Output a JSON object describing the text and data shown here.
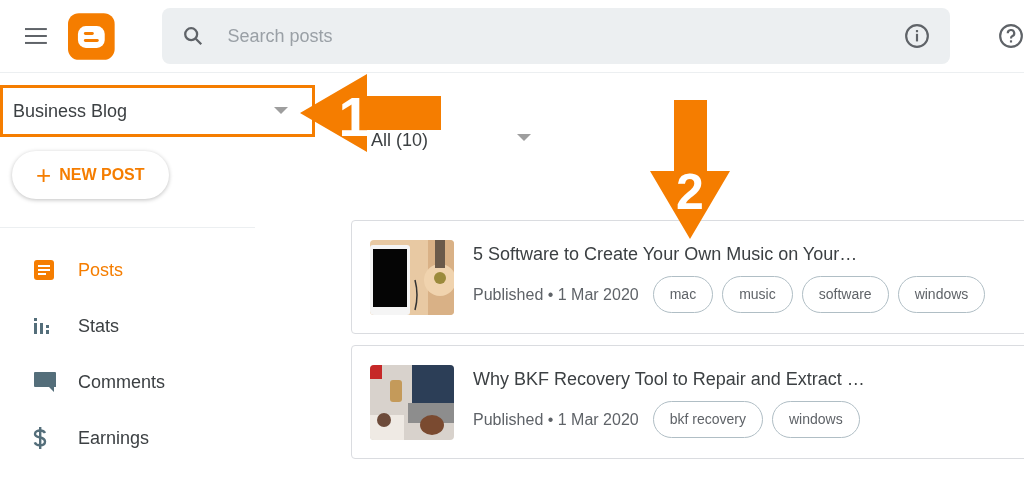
{
  "header": {
    "search": {
      "placeholder": "Search posts"
    }
  },
  "sidebar": {
    "blog_selector": {
      "value": "Business Blog"
    },
    "new_post_button": {
      "icon": "+",
      "label": "NEW POST"
    },
    "items": [
      {
        "kind": "posts",
        "label": "Posts",
        "selected": true
      },
      {
        "kind": "stats",
        "label": "Stats",
        "selected": false
      },
      {
        "kind": "comments",
        "label": "Comments",
        "selected": false
      },
      {
        "kind": "earnings",
        "label": "Earnings",
        "selected": false
      }
    ]
  },
  "filter": {
    "value": "All (10)"
  },
  "posts": [
    {
      "title": "5 Software to Create Your Own Music on Your…",
      "status": "Published • 1 Mar 2020",
      "labels": [
        "mac",
        "music",
        "software",
        "windows"
      ]
    },
    {
      "title": "Why BKF Recovery Tool to Repair and Extract …",
      "status": "Published • 1 Mar 2020",
      "labels": [
        "bkf recovery",
        "windows"
      ]
    }
  ],
  "annotations": [
    {
      "label": "1"
    },
    {
      "label": "2"
    }
  ]
}
